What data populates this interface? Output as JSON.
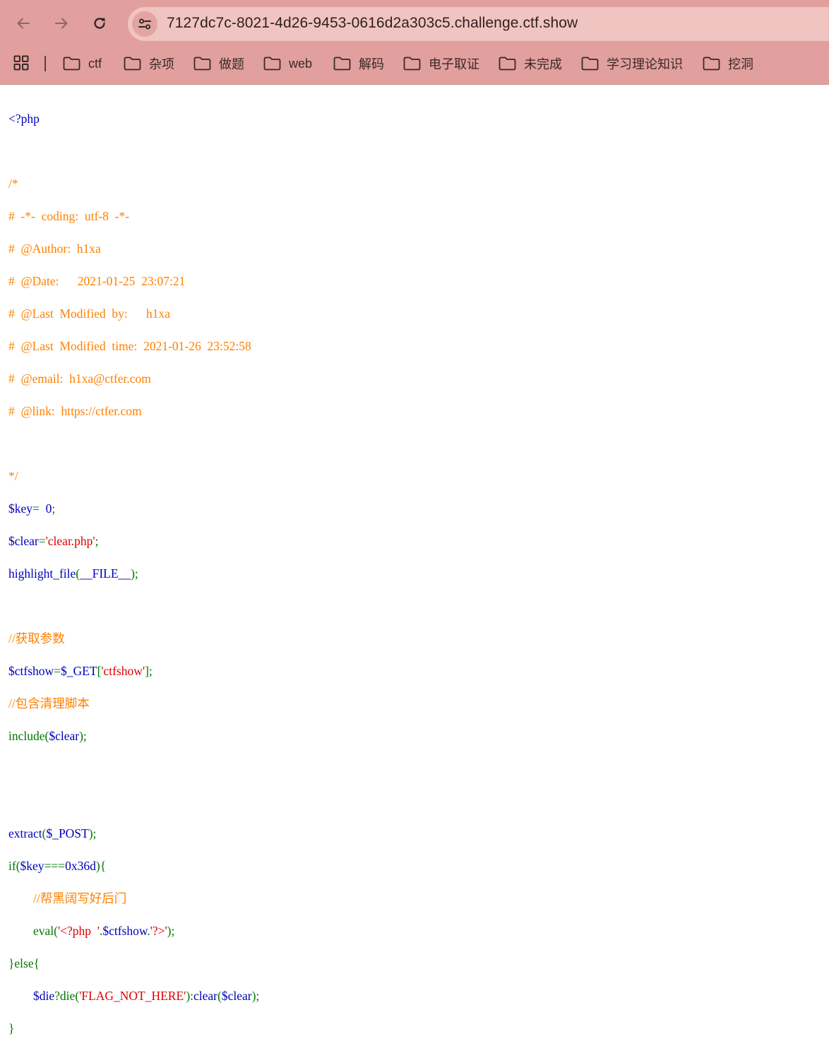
{
  "browser": {
    "url": "7127dc7c-8021-4d26-9453-0616d2a303c5.challenge.ctf.show",
    "back_icon": "arrow-left-icon",
    "forward_icon": "arrow-right-icon",
    "reload_icon": "reload-icon",
    "site_info_icon": "tune-icon"
  },
  "bookmarks": [
    {
      "label": "ctf"
    },
    {
      "label": "杂项"
    },
    {
      "label": "做题"
    },
    {
      "label": "web"
    },
    {
      "label": "解码"
    },
    {
      "label": "电子取证"
    },
    {
      "label": "未完成"
    },
    {
      "label": "学习理论知识"
    },
    {
      "label": "挖洞"
    }
  ],
  "colors": {
    "chrome_bg": "#e1a09d",
    "omnibox_bg": "#f0c4c1",
    "php_default": "#0000bb",
    "php_comment": "#ff8000",
    "php_keyword": "#007700",
    "php_string": "#dd0000"
  },
  "code": {
    "l1": "<?php",
    "l3": "/*",
    "l4": "#  -*-  coding:  utf-8  -*-",
    "l5": "#  @Author:  h1xa",
    "l6": "#  @Date:      2021-01-25  23:07:21",
    "l7": "#  @Last  Modified  by:      h1xa",
    "l8": "#  @Last  Modified  time:  2021-01-26  23:52:58",
    "l9": "#  @email:  h1xa@ctfer.com",
    "l10": "#  @link:  https://ctfer.com",
    "l12": "*/",
    "l13a": "$key",
    "l13b": "=  ",
    "l13c": "0",
    "l13d": ";",
    "l14a": "$clear",
    "l14b": "=",
    "l14c": "'clear.php'",
    "l14d": ";",
    "l15a": "highlight_file",
    "l15b": "(",
    "l15c": "__FILE__",
    "l15d": ");",
    "l17": "//获取参数",
    "l18a": "$ctfshow",
    "l18b": "=",
    "l18c": "$_GET",
    "l18d": "[",
    "l18e": "'ctfshow'",
    "l18f": "];",
    "l19": "//包含清理脚本",
    "l20a": "include(",
    "l20b": "$clear",
    "l20c": ");",
    "l23a": "extract",
    "l23b": "(",
    "l23c": "$_POST",
    "l23d": ");",
    "l24a": "if(",
    "l24b": "$key",
    "l24c": "===",
    "l24d": "0x36d",
    "l24e": "){",
    "l25": "        //帮黑阔写好后门",
    "l26a": "        ",
    "l26b": "eval",
    "l26c": "(",
    "l26d": "'<?php  '",
    "l26e": ".",
    "l26f": "$ctfshow",
    "l26g": ".",
    "l26h": "'?>'",
    "l26i": ");",
    "l27": "}else{",
    "l28a": "        ",
    "l28b": "$die",
    "l28c": "?",
    "l28d": "die",
    "l28e": "(",
    "l28f": "'FLAG_NOT_HERE'",
    "l28g": "):",
    "l28h": "clear",
    "l28i": "(",
    "l28j": "$clear",
    "l28k": ");",
    "l29": "}"
  }
}
